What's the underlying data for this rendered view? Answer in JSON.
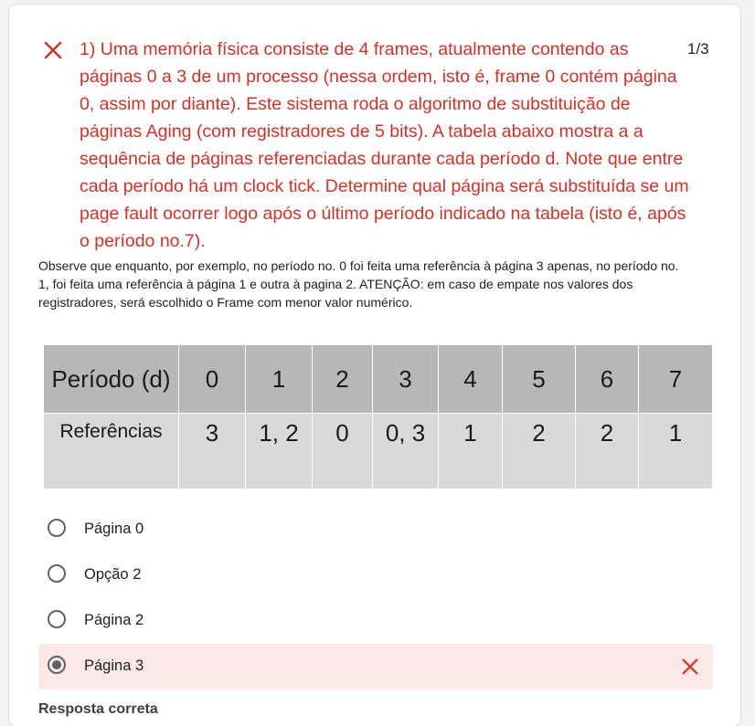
{
  "question": {
    "title": "1) Uma memória física consiste de 4 frames, atualmente contendo as páginas 0 a 3 de um processo (nessa ordem, isto é, frame 0 contém página 0, assim por diante). Este sistema roda o algoritmo de substituição de páginas Aging (com registradores de 5 bits). A tabela abaixo mostra a a sequência de páginas referenciadas durante cada período d. Note que entre cada período há um clock tick. Determine qual página será substituída se um page fault ocorrer logo após o último período indicado na tabela (isto é, após o período no.7).",
    "score": "1/3",
    "status": "incorrect",
    "description": "Observe que enquanto, por exemplo, no período no. 0 foi feita uma referência à página 3 apenas, no período no. 1, foi feita uma referência à página 1 e outra à pagina 2. ATENÇÃO: em caso de empate nos valores dos registradores, será escolhido o Frame com menor valor numérico."
  },
  "table": {
    "header_label": "Período (d)",
    "periods": [
      "0",
      "1",
      "2",
      "3",
      "4",
      "5",
      "6",
      "7"
    ],
    "row_label": "Referências",
    "references": [
      "3",
      "1, 2",
      "0",
      "0, 3",
      "1",
      "2",
      "2",
      "1"
    ]
  },
  "options": [
    {
      "label": "Página 0",
      "selected": false
    },
    {
      "label": "Opção 2",
      "selected": false
    },
    {
      "label": "Página 2",
      "selected": false
    },
    {
      "label": "Página 3",
      "selected": true,
      "wrong": true
    }
  ],
  "correct_answer_heading": "Resposta correta",
  "colors": {
    "error": "#d93025",
    "error_bg": "#fce8e6",
    "table_header": "#b7b7b7",
    "table_body": "#d9d9d9",
    "page_bg": "#f1f3f4"
  }
}
